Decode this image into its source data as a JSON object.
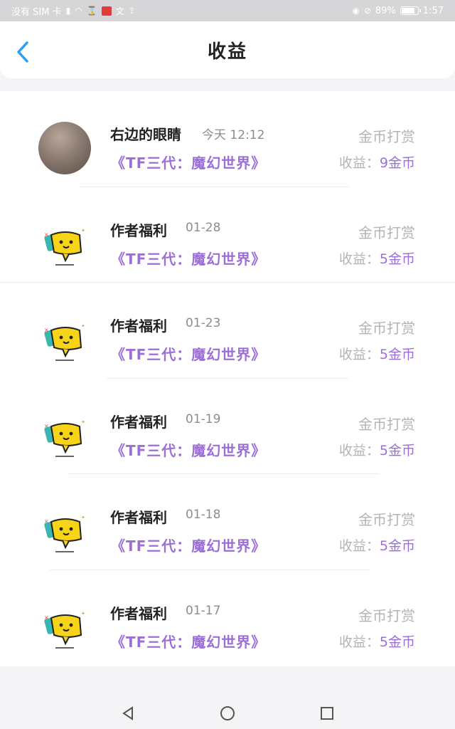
{
  "status_bar": {
    "carrier": "没有 SIM 卡",
    "battery": "89%",
    "battery_level": 0.89,
    "time": "1:57"
  },
  "header": {
    "title": "收益",
    "back_icon": "chevron-left-icon"
  },
  "colors": {
    "accent": "#9b6fd6",
    "back_icon": "#2a9df4",
    "muted": "#b4b4b4"
  },
  "rows": [
    {
      "avatar": "user-photo",
      "name": "右边的眼睛",
      "time": "今天 12:12",
      "book": "《TF三代：魔幻世界》",
      "type": "金币打赏",
      "earn_label": "收益：",
      "earn_value": "9金币"
    },
    {
      "avatar": "mascot-chat-bubble",
      "name": "作者福利",
      "time": "01-28",
      "book": "《TF三代：魔幻世界》",
      "type": "金币打赏",
      "earn_label": "收益：",
      "earn_value": "5金币"
    },
    {
      "avatar": "mascot-chat-bubble",
      "name": "作者福利",
      "time": "01-23",
      "book": "《TF三代：魔幻世界》",
      "type": "金币打赏",
      "earn_label": "收益：",
      "earn_value": "5金币"
    },
    {
      "avatar": "mascot-chat-bubble",
      "name": "作者福利",
      "time": "01-19",
      "book": "《TF三代：魔幻世界》",
      "type": "金币打赏",
      "earn_label": "收益：",
      "earn_value": "5金币"
    },
    {
      "avatar": "mascot-chat-bubble",
      "name": "作者福利",
      "time": "01-18",
      "book": "《TF三代：魔幻世界》",
      "type": "金币打赏",
      "earn_label": "收益：",
      "earn_value": "5金币"
    },
    {
      "avatar": "mascot-chat-bubble",
      "name": "作者福利",
      "time": "01-17",
      "book": "《TF三代：魔幻世界》",
      "type": "金币打赏",
      "earn_label": "收益：",
      "earn_value": "5金币"
    }
  ],
  "nav": {
    "back": "triangle-back-icon",
    "home": "circle-home-icon",
    "recents": "square-recents-icon"
  }
}
